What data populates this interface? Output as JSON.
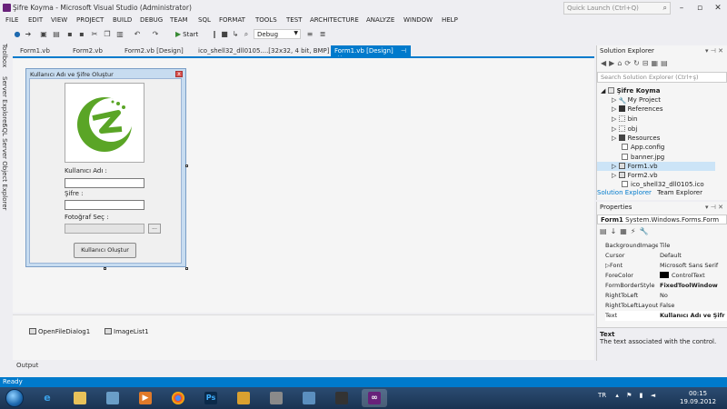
{
  "window": {
    "title": "Şifre Koyma - Microsoft Visual Studio (Administrator)",
    "quick_launch_placeholder": "Quick Launch (Ctrl+Q)"
  },
  "menu": [
    "FILE",
    "EDIT",
    "VIEW",
    "PROJECT",
    "BUILD",
    "DEBUG",
    "TEAM",
    "SQL",
    "FORMAT",
    "TOOLS",
    "TEST",
    "ARCHITECTURE",
    "ANALYZE",
    "WINDOW",
    "HELP"
  ],
  "toolbar": {
    "start_label": "Start",
    "config_value": "Debug"
  },
  "side_tabs": [
    "Toolbox",
    "Server Explorer",
    "SQL Server Object Explorer"
  ],
  "doc_tabs": [
    "Form1.vb",
    "Form2.vb",
    "Form2.vb [Design]",
    "ico_shell32_dll0105....[32x32, 4 bit, BMP]",
    "Form1.vb [Design]"
  ],
  "form": {
    "title": "Kullanıcı Adı ve Şifre Oluştur",
    "username_label": "Kullanıcı Adı :",
    "password_label": "Şifre :",
    "photo_label": "Fotoğraf Seç :",
    "browse_label": "...",
    "create_button": "Kullanıcı Oluştur"
  },
  "tray_components": [
    "OpenFileDialog1",
    "ImageList1"
  ],
  "output_tab": "Output",
  "solution_explorer": {
    "title": "Solution Explorer",
    "search_placeholder": "Search Solution Explorer (Ctrl+ş)",
    "items": [
      {
        "label": "Şifre Koyma",
        "level": 0,
        "icon": "project"
      },
      {
        "label": "My Project",
        "level": 1,
        "icon": "wrench"
      },
      {
        "label": "References",
        "level": 1,
        "icon": "references"
      },
      {
        "label": "bin",
        "level": 1,
        "icon": "folder"
      },
      {
        "label": "obj",
        "level": 1,
        "icon": "folder"
      },
      {
        "label": "Resources",
        "level": 1,
        "icon": "folder-dark"
      },
      {
        "label": "App.config",
        "level": 1,
        "icon": "config"
      },
      {
        "label": "banner.jpg",
        "level": 1,
        "icon": "image"
      },
      {
        "label": "Form1.vb",
        "level": 1,
        "icon": "form"
      },
      {
        "label": "Form2.vb",
        "level": 1,
        "icon": "form"
      },
      {
        "label": "ico_shell32_dll0105.ico",
        "level": 1,
        "icon": "ico"
      }
    ],
    "tabs": [
      "Solution Explorer",
      "Team Explorer"
    ]
  },
  "properties": {
    "title": "Properties",
    "object": "Form1",
    "object_type": "System.Windows.Forms.Form",
    "rows": [
      {
        "name": "BackgroundImage",
        "value": "Tile"
      },
      {
        "name": "Cursor",
        "value": "Default"
      },
      {
        "name": "Font",
        "value": "Microsoft Sans Serif"
      },
      {
        "name": "ForeColor",
        "value": "ControlText"
      },
      {
        "name": "FormBorderStyle",
        "value": "FixedToolWindow"
      },
      {
        "name": "RightToLeft",
        "value": "No"
      },
      {
        "name": "RightToLeftLayout",
        "value": "False"
      },
      {
        "name": "Text",
        "value": "Kullanıcı Adı ve Şifr"
      }
    ],
    "desc_title": "Text",
    "desc_text": "The text associated with the control."
  },
  "status": "Ready",
  "taskbar": {
    "lang": "TR",
    "time": "00:15",
    "date": "19.09.2012",
    "apps": [
      "ie",
      "explorer",
      "network",
      "media",
      "chrome",
      "photoshop",
      "tools",
      "storage",
      "tool2",
      "visual-studio"
    ]
  },
  "colors": {
    "accent": "#007acc",
    "vs_purple": "#68217a"
  }
}
